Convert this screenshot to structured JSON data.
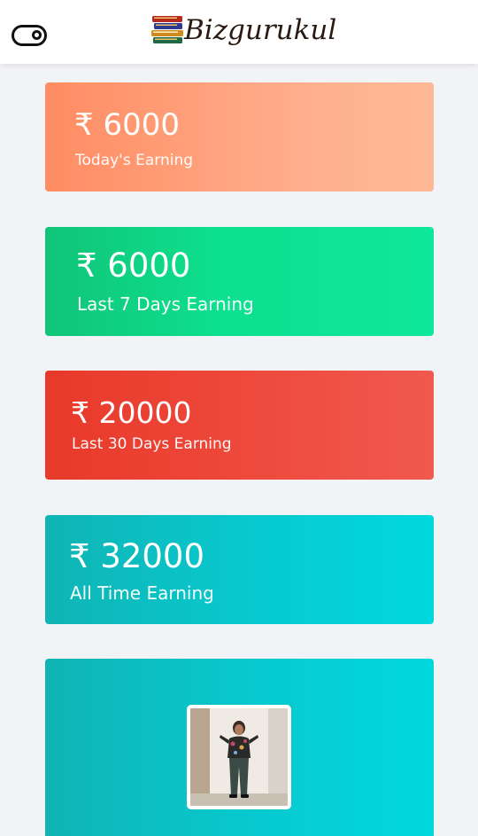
{
  "header": {
    "theme_toggle_icon": "toggle-switch-icon",
    "logo_icon": "books-logo-icon",
    "logo_text": "Bizgurukul"
  },
  "cards": [
    {
      "amount": "₹ 6000",
      "label": "Today's Earning",
      "color": "#ff8c62"
    },
    {
      "amount": "₹ 6000",
      "label": "Last 7 Days Earning",
      "color": "#11c478"
    },
    {
      "amount": "₹ 20000",
      "label": "Last 30 Days Earning",
      "color": "#e8392a"
    },
    {
      "amount": "₹ 32000",
      "label": "All Time Earning",
      "color": "#10b4b4"
    }
  ],
  "profile": {
    "icon": "profile-photo"
  }
}
